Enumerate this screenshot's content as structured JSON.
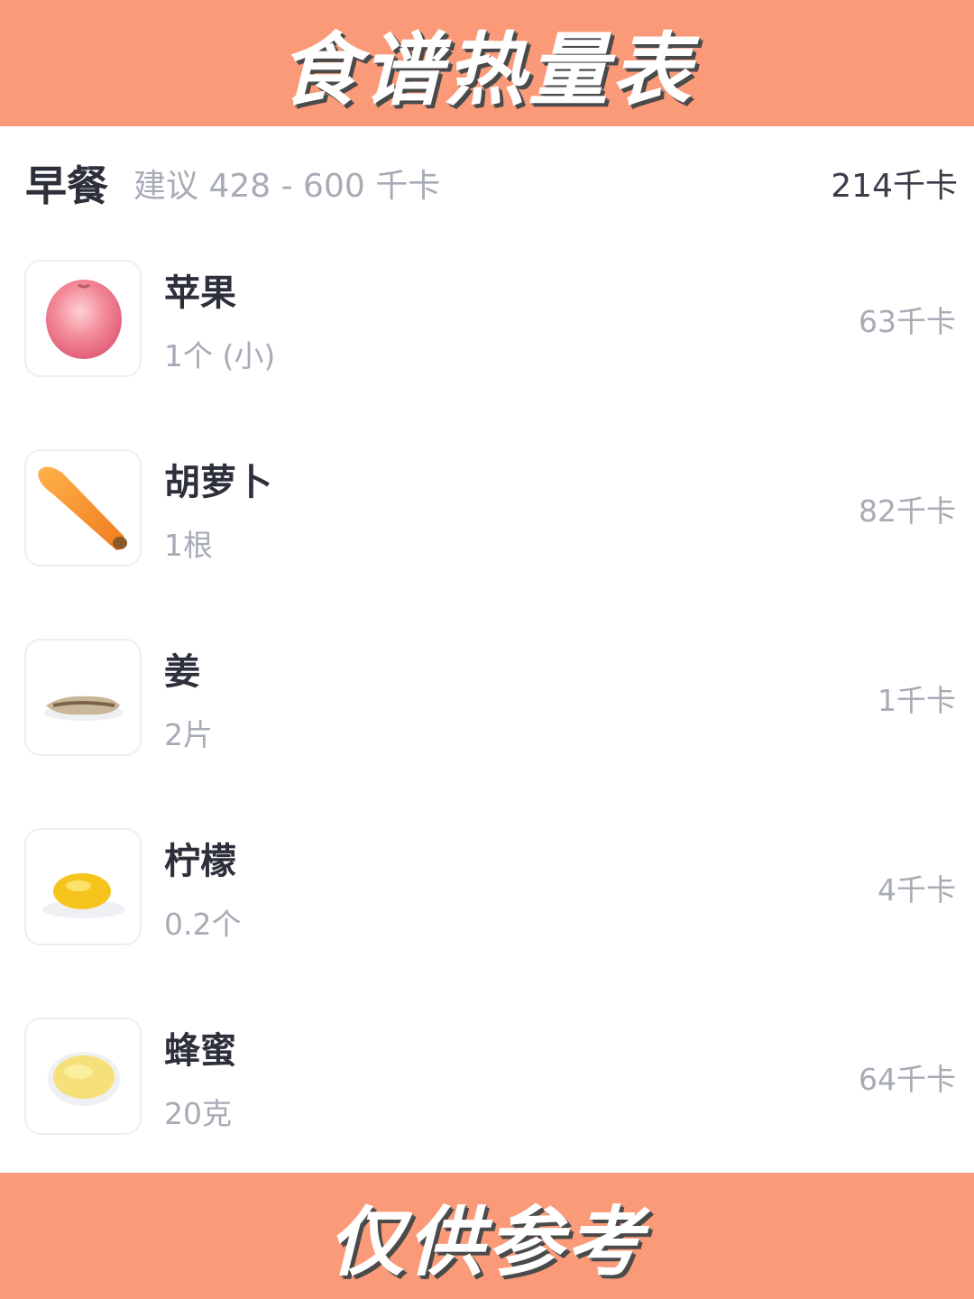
{
  "header": {
    "title": "食谱热量表"
  },
  "meal": {
    "name": "早餐",
    "suggestion": "建议 428 - 600 千卡",
    "total": "214千卡"
  },
  "foods": [
    {
      "name": "苹果",
      "amount": "1个 (小)",
      "kcal": "63千卡",
      "icon": "apple-icon"
    },
    {
      "name": "胡萝卜",
      "amount": "1根",
      "kcal": "82千卡",
      "icon": "carrot-icon"
    },
    {
      "name": "姜",
      "amount": "2片",
      "kcal": "1千卡",
      "icon": "ginger-icon"
    },
    {
      "name": "柠檬",
      "amount": "0.2个",
      "kcal": "4千卡",
      "icon": "lemon-icon"
    },
    {
      "name": "蜂蜜",
      "amount": "20克",
      "kcal": "64千卡",
      "icon": "honey-icon"
    }
  ],
  "footer": {
    "note": "仅供参考"
  },
  "colors": {
    "banner": "#fa9a78",
    "title_text": "#2d2f3a",
    "muted_text": "#a7abb5"
  }
}
